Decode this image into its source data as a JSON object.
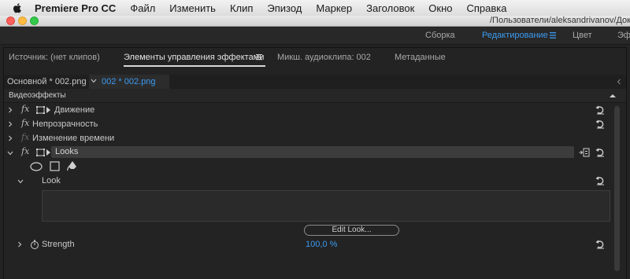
{
  "menubar": {
    "app_name": "Premiere Pro CC",
    "items": [
      "Файл",
      "Изменить",
      "Клип",
      "Эпизод",
      "Маркер",
      "Заголовок",
      "Окно",
      "Справка"
    ]
  },
  "titlebar": {
    "path": "/Пользователи/aleksandrivanov/Доку"
  },
  "workspaces": {
    "items": [
      {
        "label": "Сборка",
        "active": false
      },
      {
        "label": "Редактирование",
        "active": true
      },
      {
        "label": "Цвет",
        "active": false
      },
      {
        "label": "Эф",
        "active": false
      }
    ]
  },
  "panel": {
    "tabs": [
      {
        "label": "Источник: (нет клипов)",
        "active": false
      },
      {
        "label": "Элементы управления эффектами",
        "active": true
      },
      {
        "label": "Микш. аудиоклипа: 002",
        "active": false
      },
      {
        "label": "Метаданные",
        "active": false
      }
    ],
    "clip_master": "Основной * 002.png",
    "clip_current": "002 * 002.png"
  },
  "effects": {
    "section_title": "Видеоэффекты",
    "rows": {
      "motion": "Движение",
      "opacity": "Непрозрачность",
      "time_remap": "Изменение времени",
      "looks": "Looks",
      "look": "Look",
      "strength": "Strength"
    },
    "fx_label": "fx",
    "edit_look_button": "Edit Look...",
    "strength_value": "100,0 %"
  },
  "colors": {
    "accent": "#3b9bf2",
    "panel_bg": "#232323"
  }
}
